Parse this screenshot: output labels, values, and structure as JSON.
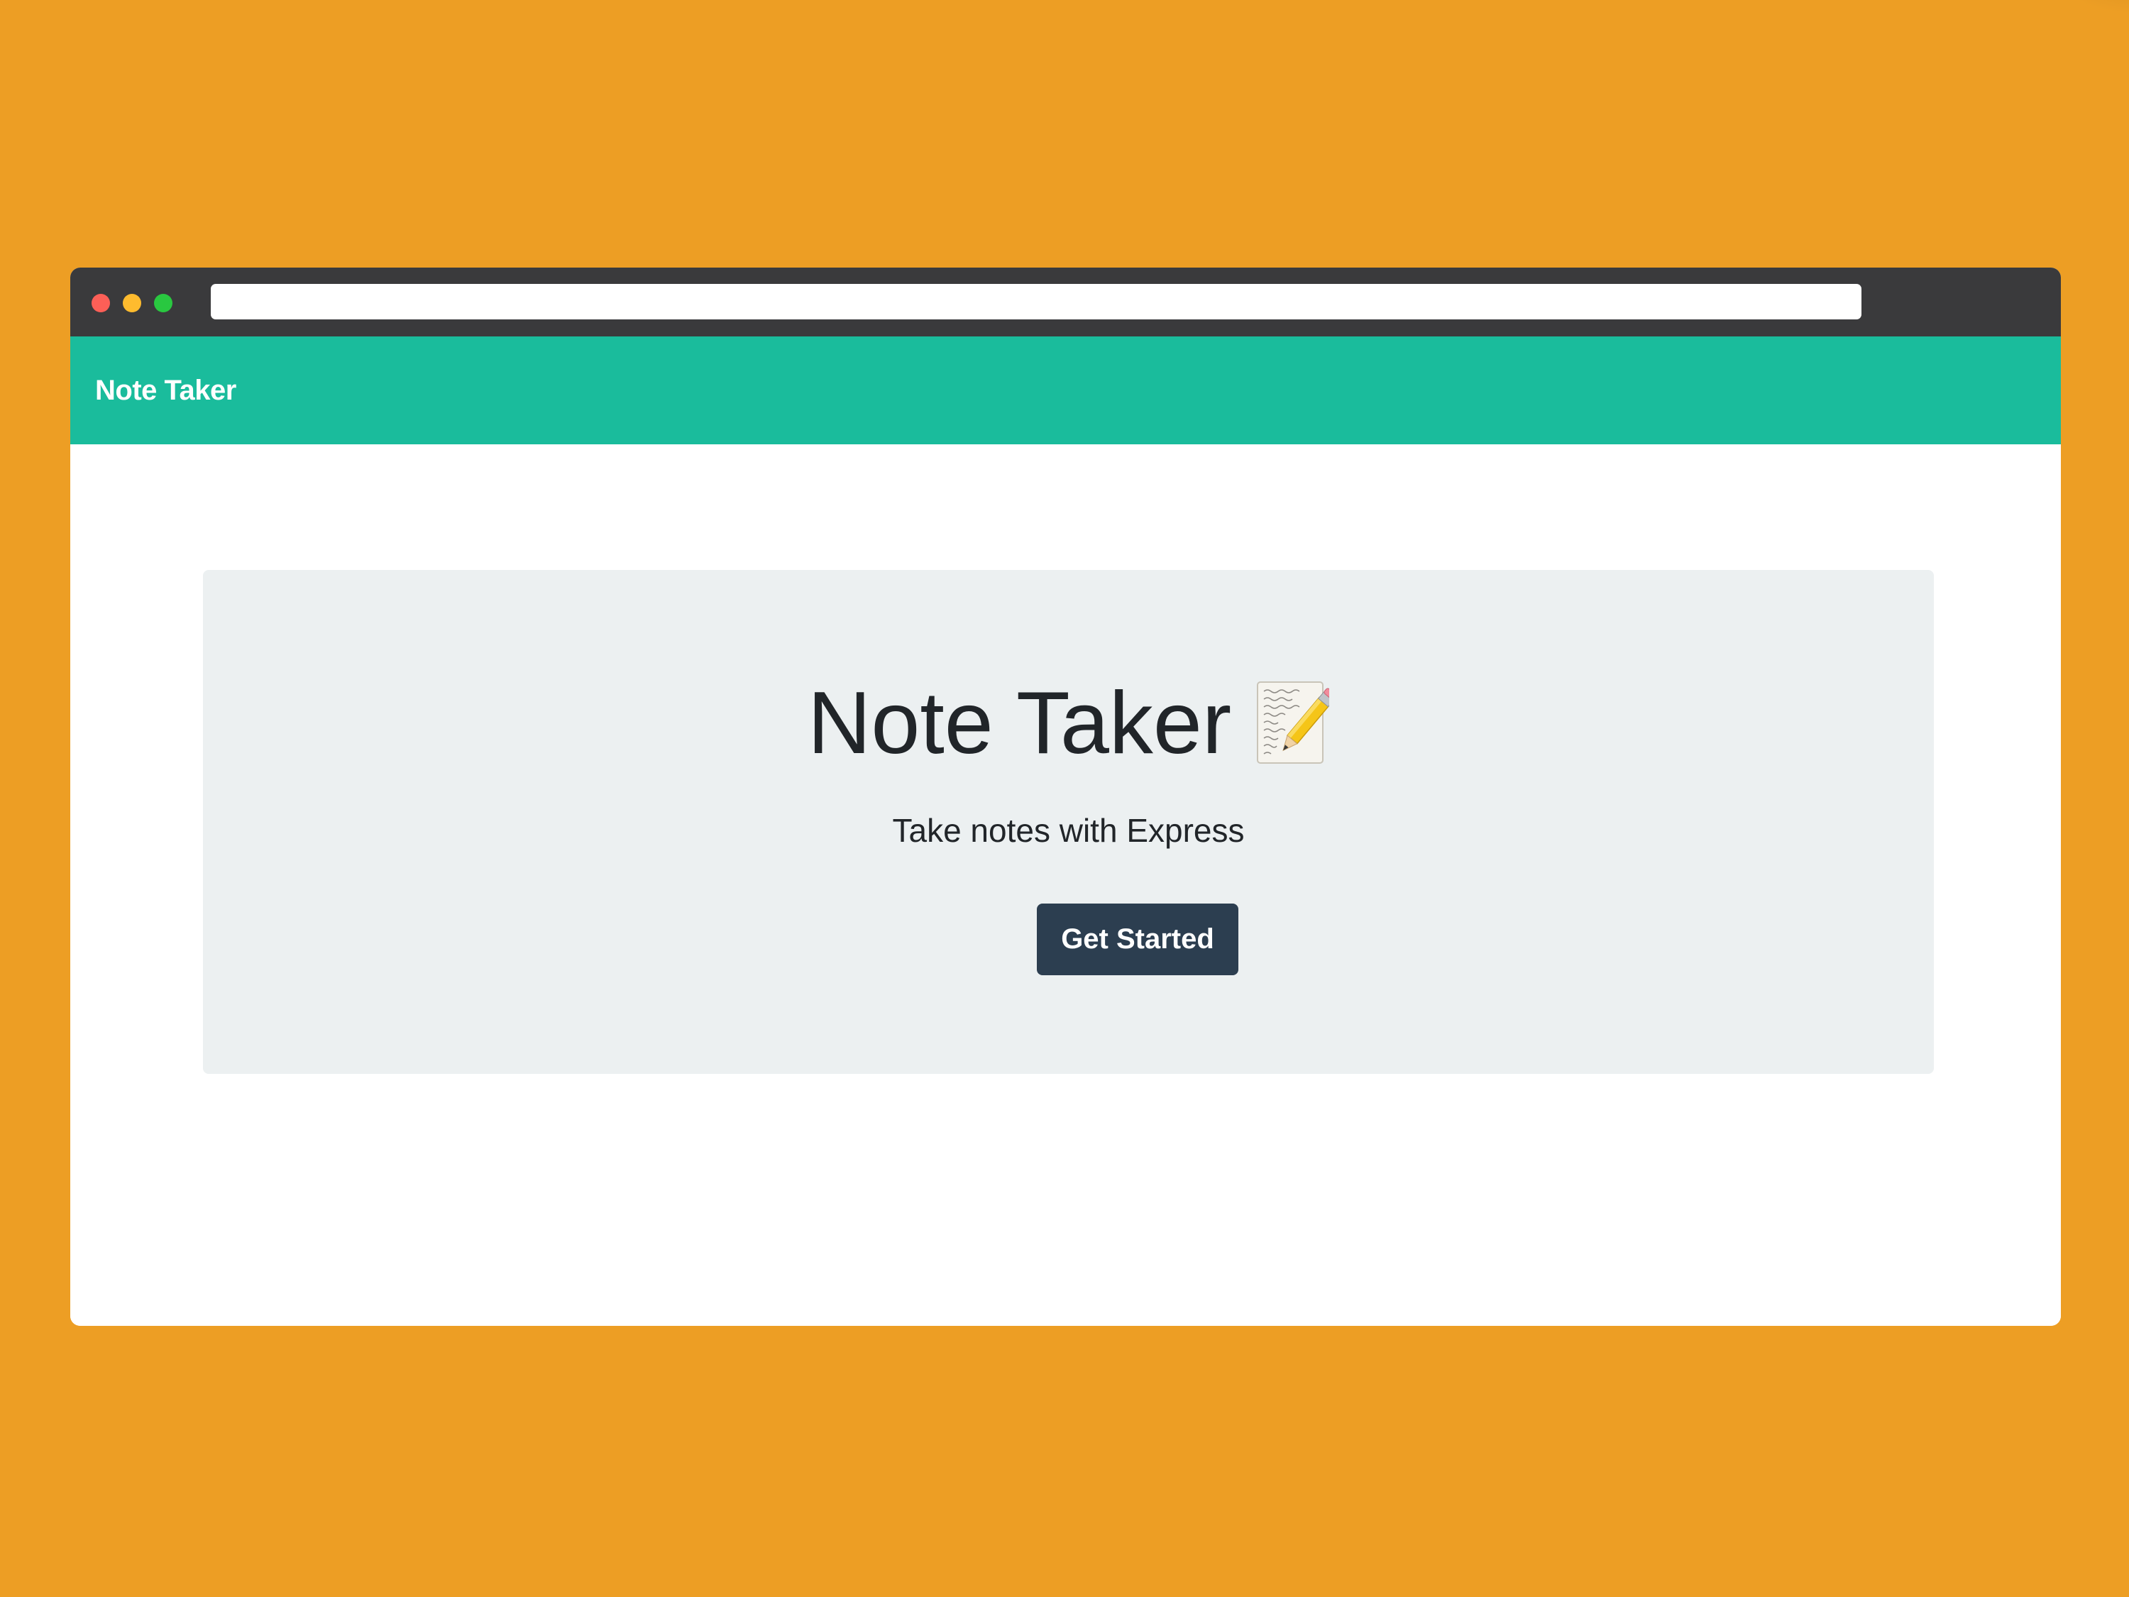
{
  "background": {
    "color": "#ed9e24"
  },
  "browser": {
    "chrome_color": "#3a3a3c",
    "traffic_lights": [
      {
        "name": "close",
        "color": "#fc5f57"
      },
      {
        "name": "minimize",
        "color": "#febb2e"
      },
      {
        "name": "maximize",
        "color": "#29c840"
      }
    ],
    "address_bar": {
      "value": ""
    }
  },
  "navbar": {
    "brand": "Note Taker",
    "color": "#1abc9c"
  },
  "hero": {
    "title": "Note Taker",
    "title_icon": "memo-icon",
    "subtitle": "Take notes with Express",
    "button_label": "Get Started",
    "panel_color": "#ecf0f1",
    "button_color": "#2c3e50"
  }
}
